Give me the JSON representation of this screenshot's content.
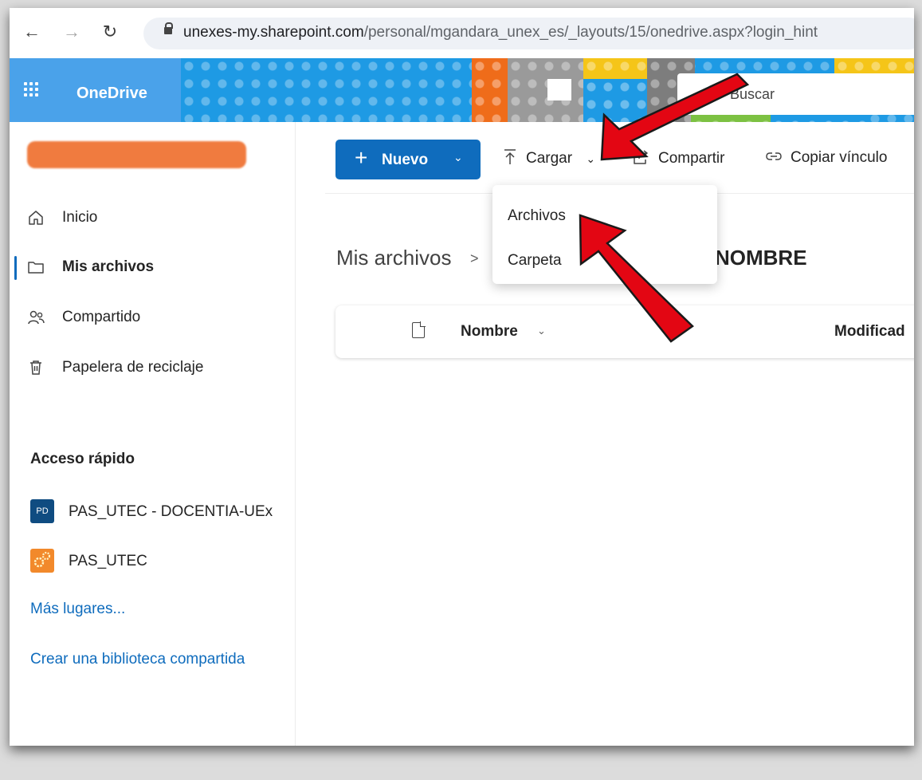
{
  "browser": {
    "back_icon": "arrow-left-icon",
    "forward_icon": "arrow-right-icon",
    "reload_icon": "reload-icon",
    "url_host": "unexes-my.sharepoint.com",
    "url_path": "/personal/mgandara_unex_es/_layouts/15/onedrive.aspx?login_hint"
  },
  "header": {
    "app_name": "OneDrive",
    "search_placeholder": "Buscar"
  },
  "sidebar": {
    "items": [
      {
        "label": "Inicio",
        "icon": "home-icon"
      },
      {
        "label": "Mis archivos",
        "icon": "folder-icon",
        "active": true
      },
      {
        "label": "Compartido",
        "icon": "people-icon"
      },
      {
        "label": "Papelera de reciclaje",
        "icon": "trash-icon"
      }
    ],
    "quick_access_title": "Acceso rápido",
    "quick_access": [
      {
        "badge": "PD",
        "label": "PAS_UTEC - DOCENTIA-UEx",
        "color": "#0f4c81"
      },
      {
        "badge": "",
        "label": "PAS_UTEC",
        "color": "#f2892b"
      }
    ],
    "more_places": "Más lugares...",
    "create_library": "Crear una biblioteca compartida"
  },
  "commandbar": {
    "new_label": "Nuevo",
    "upload_label": "Cargar",
    "share_label": "Compartir",
    "copy_link_label": "Copiar vínculo"
  },
  "upload_menu": {
    "items": [
      "Archivos",
      "Carpeta"
    ]
  },
  "breadcrumb": {
    "root": "Mis archivos",
    "current": "NOMBRE"
  },
  "file_list": {
    "col_name": "Nombre",
    "col_modified": "Modificad"
  },
  "colors": {
    "accent": "#0f6cbd",
    "header_blue": "#4aa2ea",
    "annotation_arrow": "#e30613"
  }
}
